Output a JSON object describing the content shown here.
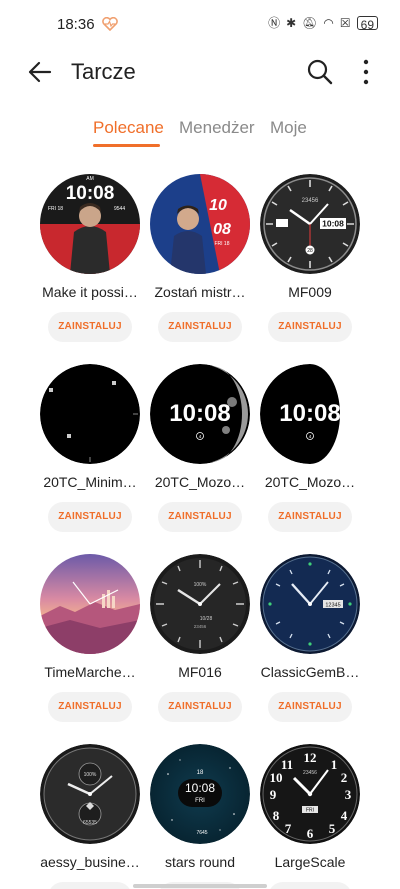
{
  "status_bar": {
    "time": "18:36",
    "icons": [
      "nfc-icon",
      "bluetooth-icon",
      "mute-icon",
      "wifi-icon",
      "x-box-icon"
    ],
    "battery": "69"
  },
  "header": {
    "title": "Tarcze"
  },
  "tabs": [
    {
      "label": "Polecane",
      "active": true
    },
    {
      "label": "Menedżer",
      "active": false
    },
    {
      "label": "Moje",
      "active": false
    }
  ],
  "install_label": "ZAINSTALUJ",
  "watch_faces": [
    {
      "name": "Make it possi…",
      "face_text": {
        "time": "10:08",
        "top": "AM",
        "date": "FRI 18",
        "steps": "9544"
      }
    },
    {
      "name": "Zostań mistr…",
      "face_text": {
        "hour": "10",
        "minute": "08",
        "date": "FRI 18"
      }
    },
    {
      "name": "MF009",
      "face_text": {
        "steps": "23456",
        "time": "10:08",
        "day": "28"
      }
    },
    {
      "name": "20TC_Minim…",
      "face_text": {}
    },
    {
      "name": "20TC_Mozo…",
      "face_text": {
        "time": "10:08",
        "small": "4"
      }
    },
    {
      "name": "20TC_Mozo…",
      "face_text": {
        "time": "10:08",
        "small": "4"
      }
    },
    {
      "name": "TimeMarche…",
      "face_text": {}
    },
    {
      "name": "MF016",
      "face_text": {
        "percent": "100%",
        "date": "10/28",
        "steps": "23456"
      }
    },
    {
      "name": "ClassicGemB…",
      "face_text": {
        "date": "12345"
      }
    },
    {
      "name": "aessy_busine…",
      "face_text": {
        "percent": "100%",
        "steps": "65535"
      }
    },
    {
      "name": "stars round",
      "face_text": {
        "day": "18",
        "time": "10:08",
        "weekday": "FRI",
        "steps": "7645"
      }
    },
    {
      "name": "LargeScale",
      "face_text": {
        "steps": "23456",
        "day": "FRI"
      }
    }
  ],
  "colors": {
    "accent": "#f06f2a",
    "button_bg": "#f2f2f2"
  }
}
